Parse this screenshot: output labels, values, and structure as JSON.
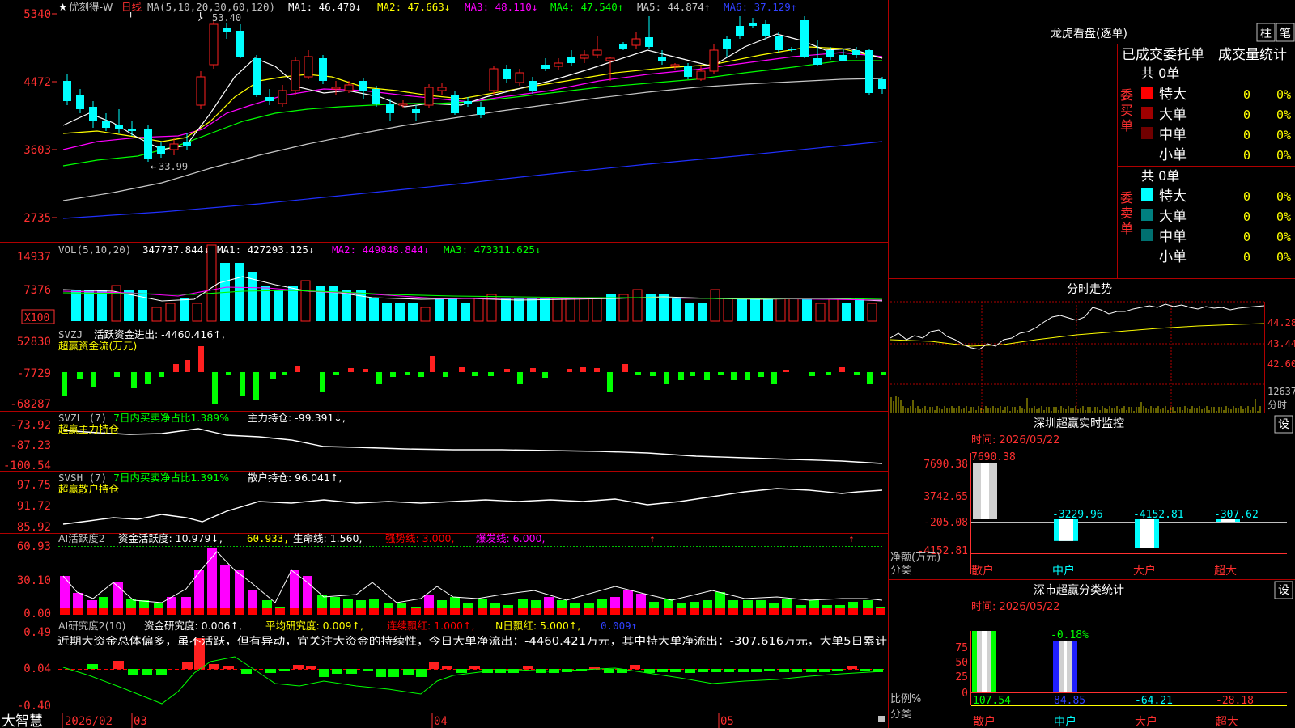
{
  "main": {
    "title": "优刻得-W",
    "period": "日线",
    "ma_label": "MA(5,10,20,30,60,120)",
    "ma": [
      {
        "label": "MA1: 46.470↓",
        "color": "#ffffff"
      },
      {
        "label": "MA2: 47.663↓",
        "color": "#ffff00"
      },
      {
        "label": "MA3: 48.110↓",
        "color": "#ff00ff"
      },
      {
        "label": "MA4: 47.540↑",
        "color": "#00ff00"
      },
      {
        "label": "MA5: 44.874↑",
        "color": "#c8c8c8"
      },
      {
        "label": "MA6: 37.129↑",
        "color": "#3040ff"
      }
    ],
    "yticks": [
      "5340",
      "4472",
      "3603",
      "2735"
    ],
    "ann_high": "53.40",
    "ann_low": "33.99"
  },
  "vol": {
    "label": "VOL(5,10,20)",
    "value": "347737.844↓",
    "ma": [
      {
        "label": "MA1: 427293.125↓",
        "color": "#ffffff"
      },
      {
        "label": "MA2: 449848.844↓",
        "color": "#ff00ff"
      },
      {
        "label": "MA3: 473311.625↓",
        "color": "#00ff00"
      }
    ],
    "yticks": [
      "14937",
      "7376"
    ],
    "unit": "X100"
  },
  "svzj": {
    "label": "SVZJ",
    "text1": "活跃资金进出: -4460.416↑,",
    "text2": "超赢资金流(万元)",
    "yticks": [
      "52830",
      "-7729",
      "-68287"
    ]
  },
  "svzl": {
    "label": "SVZL (7)",
    "text1": "7日内买卖净占比1.389%",
    "text2": "主力持仓: -99.391↓,",
    "text3": "超赢主力持仓",
    "yticks": [
      "-73.92",
      "-87.23",
      "-100.54"
    ]
  },
  "svsh": {
    "label": "SVSH (7)",
    "text1": "7日内买卖净占比1.391%",
    "text2": "散户持仓: 96.041↑,",
    "text3": "超赢散户持仓",
    "yticks": [
      "97.75",
      "91.72",
      "85.92"
    ]
  },
  "ai1": {
    "label": "AI活跃度2",
    "t1": "资金活跃度: 10.979↓,",
    "t2": "60.933,",
    "t3": "生命线: 1.560,",
    "t4": "强势线: 3.000,",
    "t5": "爆发线: 6.000,",
    "yticks": [
      "60.93",
      "30.10",
      "0.00"
    ]
  },
  "ai2": {
    "label": "AI研究度2(10)",
    "t1": "资金研究度: 0.006↑,",
    "t2": "平均研究度: 0.009↑,",
    "t3": "连续飘红: 1.000↑,",
    "t4": "N日飘红: 5.000↑,",
    "t5": "0.009↑",
    "comment": "近期大资金总体偏多，虽不活跃，但有异动，宜关注大资金的持续性，今日大单净流出：-4460.421万元，其中特大单净流出：-307.616万元，大单5日累计",
    "yticks": [
      "0.49",
      "0.04",
      "-0.40"
    ]
  },
  "xaxis": {
    "brand": "大智慧",
    "labels": [
      "2026/02",
      "03",
      "04",
      "05"
    ]
  },
  "lhb": {
    "title": "龙虎看盘(逐单)",
    "btn1": "柱",
    "btn2": "笔",
    "tab1": "已成交",
    "tab2": "委托单",
    "tab3": "成交量统计",
    "buy_label": "委买单",
    "sell_label": "委卖单",
    "buy_total": "共 0单",
    "sell_total": "共 0单",
    "buy_rows": [
      {
        "name": "特大",
        "color": "#ff0000",
        "count": "0",
        "pct": "0%"
      },
      {
        "name": "大单",
        "color": "#a00000",
        "count": "0",
        "pct": "0%"
      },
      {
        "name": "中单",
        "color": "#700000",
        "count": "0",
        "pct": "0%"
      },
      {
        "name": "小单",
        "color": "",
        "count": "0",
        "pct": "0%"
      }
    ],
    "sell_rows": [
      {
        "name": "特大",
        "color": "#00ffff",
        "count": "0",
        "pct": "0%"
      },
      {
        "name": "大单",
        "color": "#008080",
        "count": "0",
        "pct": "0%"
      },
      {
        "name": "中单",
        "color": "#007070",
        "count": "0",
        "pct": "0%"
      },
      {
        "name": "小单",
        "color": "",
        "count": "0",
        "pct": "0%"
      }
    ]
  },
  "intraday": {
    "title": "分时走势",
    "yticks": [
      "44.28",
      "43.44",
      "42.60"
    ],
    "vol_label": "12637",
    "x_label": "分时"
  },
  "sz_monitor": {
    "title": "深圳超赢实时监控",
    "btn": "设",
    "time": "时间: 2026/05/22",
    "ylabel1": "净额(万元)",
    "ylabel2": "分类",
    "yticks": [
      "7690.38",
      "3742.65",
      "-205.08",
      "-4152.81"
    ],
    "categories": [
      "散户",
      "中户",
      "大户",
      "超大"
    ],
    "values": [
      7690.38,
      -3229.96,
      -4152.81,
      -307.62
    ],
    "value_labels": [
      "7690.38",
      "-3229.96",
      "-4152.81",
      "-307.62"
    ]
  },
  "sz_stats": {
    "title": "深市超赢分类统计",
    "btn": "设",
    "time": "时间: 2026/05/22",
    "ylabel1": "比例%",
    "ylabel2": "分类",
    "yticks": [
      "75",
      "50",
      "25",
      "0"
    ],
    "categories": [
      "散户",
      "中户",
      "大户",
      "超大"
    ],
    "top_label": "-0.18%",
    "values": [
      "107.54",
      "84.85",
      "-64.21",
      "-28.18"
    ]
  },
  "chart_data": {
    "type": "candlestick",
    "title": "优刻得-W 日线",
    "x": [
      "2026/02",
      "03",
      "04",
      "05"
    ],
    "price_range": [
      27.35,
      53.4
    ],
    "high_marker": 53.4,
    "low_marker": 33.99,
    "ma_latest": {
      "MA5": 46.47,
      "MA10": 47.663,
      "MA20": 48.11,
      "MA30": 47.54,
      "MA60": 44.874,
      "MA120": 37.129
    },
    "volume_latest": 347737.844,
    "svzj_latest": -4460.416,
    "sz_net_flow": {
      "categories": [
        "散户",
        "中户",
        "大户",
        "超大"
      ],
      "values": [
        7690.38,
        -3229.96,
        -4152.81,
        -307.62
      ]
    }
  }
}
